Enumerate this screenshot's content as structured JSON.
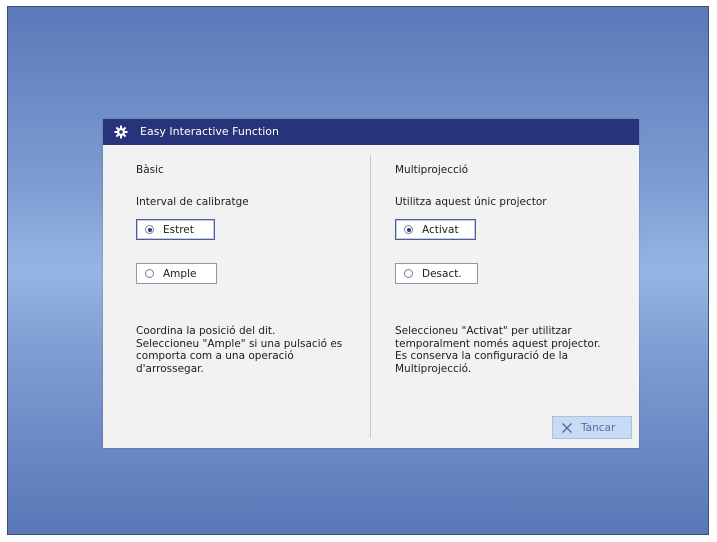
{
  "dialog": {
    "title": "Easy Interactive Function",
    "title_icon": "gear-icon"
  },
  "left": {
    "heading": "Bàsic",
    "field_label": "Interval de calibratge",
    "options": [
      {
        "label": "Estret",
        "selected": true
      },
      {
        "label": "Ample",
        "selected": false
      }
    ],
    "description": [
      "Coordina la posició del dit.",
      "Seleccioneu \"Ample\" si una pulsació es",
      "comporta com a una operació",
      "d'arrossegar."
    ]
  },
  "right": {
    "heading": "Multiprojecció",
    "field_label": "Utilitza aquest únic projector",
    "options": [
      {
        "label": "Activat",
        "selected": true
      },
      {
        "label": "Desact.",
        "selected": false
      }
    ],
    "description": [
      "Seleccioneu \"Activat\" per utilitzar",
      "temporalment només aquest projector.",
      "Es conserva la configuració de la",
      "Multiprojecció."
    ]
  },
  "buttons": {
    "cancel_label": "Tancar",
    "cancel_icon": "close-icon"
  },
  "colors": {
    "titlebar": "#27337a",
    "dialog_bg": "#f2f2f2",
    "cancel_bg": "#c7dbf4",
    "cancel_text": "#4f6fa9"
  }
}
